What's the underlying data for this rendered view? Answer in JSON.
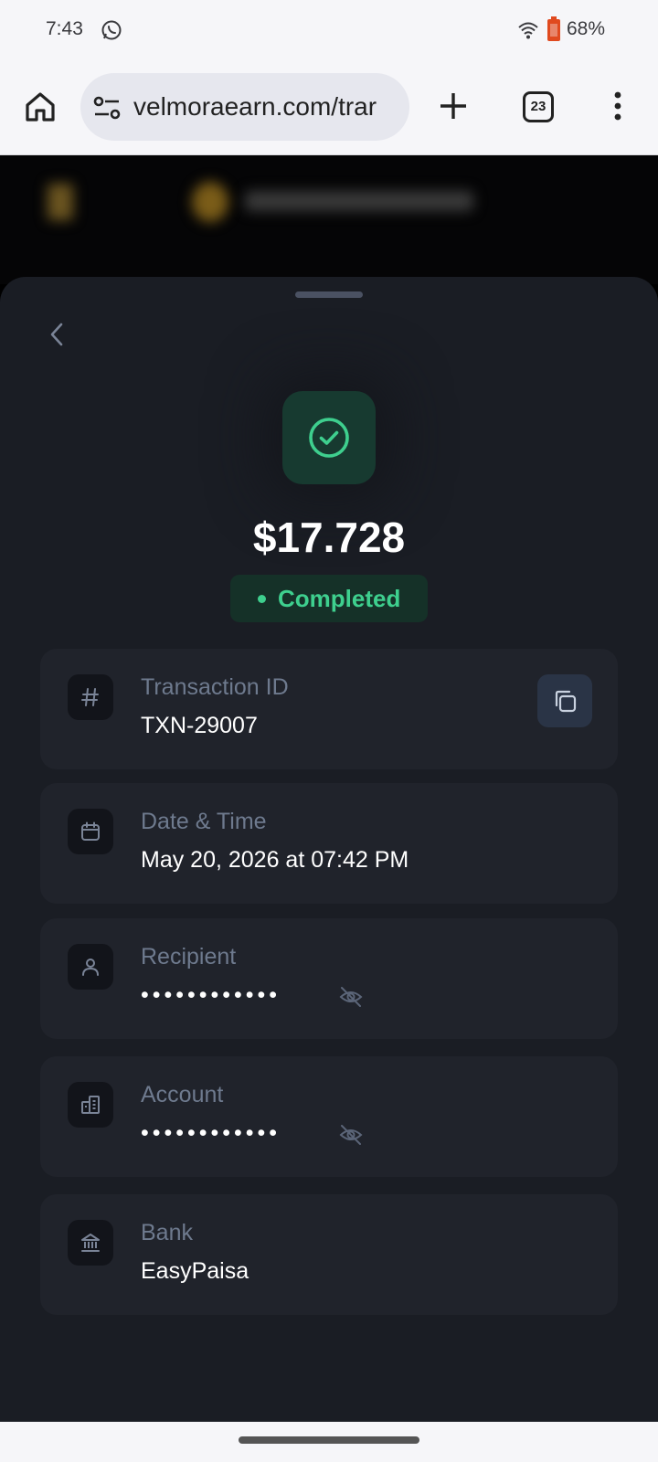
{
  "status_bar": {
    "time": "7:43",
    "battery": "68%"
  },
  "browser": {
    "url": "velmoraearn.com/trar",
    "tab_count": "23"
  },
  "transaction": {
    "amount": "$17.728",
    "status": "Completed",
    "fields": {
      "transaction_id": {
        "label": "Transaction ID",
        "value": "TXN-29007"
      },
      "date_time": {
        "label": "Date & Time",
        "value": "May 20, 2026 at 07:42 PM"
      },
      "recipient": {
        "label": "Recipient",
        "value": "••••••••••••"
      },
      "account": {
        "label": "Account",
        "value": "••••••••••••"
      },
      "bank": {
        "label": "Bank",
        "value": "EasyPaisa"
      }
    }
  },
  "colors": {
    "success": "#3ecf8e",
    "sheet_bg": "#1a1d24",
    "card_bg": "#20232b"
  }
}
